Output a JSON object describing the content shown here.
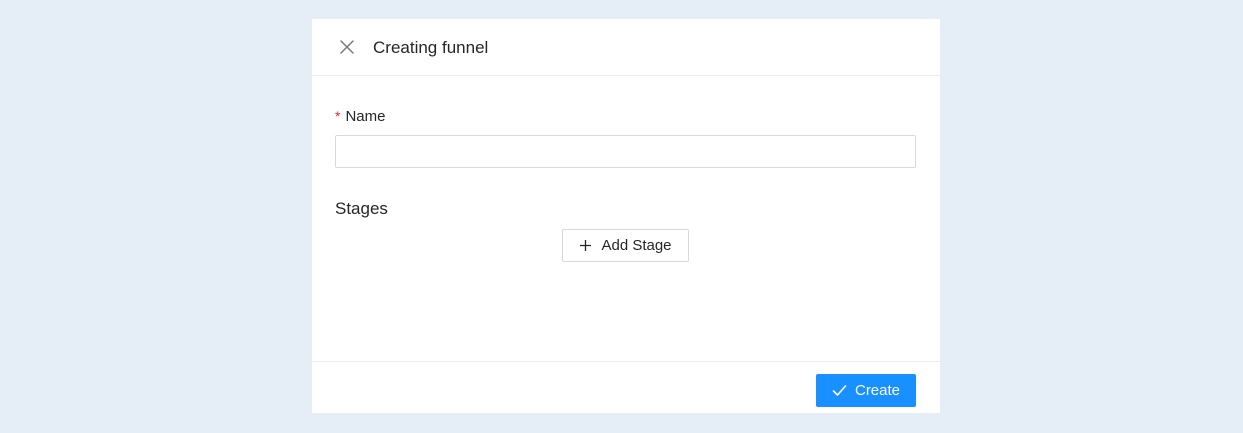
{
  "modal": {
    "title": "Creating funnel",
    "close_icon": "close-icon"
  },
  "form": {
    "name_field": {
      "required_mark": "*",
      "label": "Name",
      "value": "",
      "placeholder": ""
    },
    "stages": {
      "label": "Stages",
      "add_button_label": "Add Stage",
      "add_button_icon": "plus-icon"
    }
  },
  "footer": {
    "create_button_label": "Create",
    "create_button_icon": "check-icon"
  },
  "colors": {
    "background": "#e5edf6",
    "primary": "#1890ff",
    "required": "#f5222d",
    "border": "#d9d9d9"
  }
}
